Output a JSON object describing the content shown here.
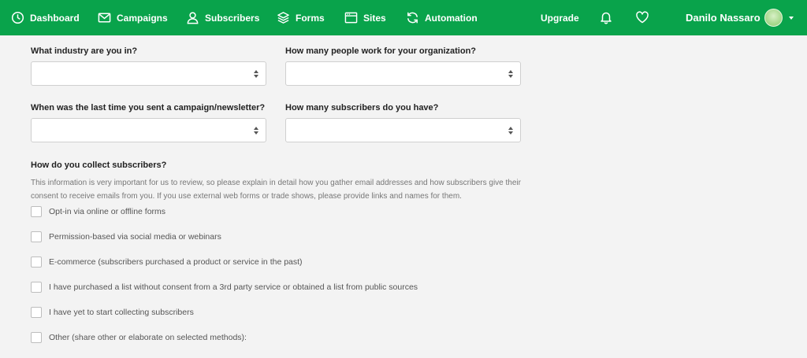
{
  "nav": {
    "dashboard": "Dashboard",
    "campaigns": "Campaigns",
    "subscribers": "Subscribers",
    "forms": "Forms",
    "sites": "Sites",
    "automation": "Automation",
    "upgrade": "Upgrade",
    "bell_icon": "bell-icon",
    "heart_icon": "heart-icon",
    "user_name": "Danilo Nassaro"
  },
  "colors": {
    "brand_green": "#09a34b"
  },
  "form": {
    "industry_label": "What industry are you in?",
    "industry_value": "",
    "people_label": "How many people work for your organization?",
    "people_value": "",
    "last_campaign_label": "When was the last time you sent a campaign/newsletter?",
    "last_campaign_value": "",
    "subscribers_count_label": "How many subscribers do you have?",
    "subscribers_count_value": "",
    "collect_title": "How do you collect subscribers?",
    "collect_description": "This information is very important for us to review, so please explain in detail how you gather email addresses and how subscribers give their consent to receive emails from you. If you use external web forms or trade shows, please provide links and names for them.",
    "options": [
      "Opt-in via online or offline forms",
      "Permission-based via social media or webinars",
      "E-commerce (subscribers purchased a product or service in the past)",
      "I have purchased a list without consent from a 3rd party service or obtained a list from public sources",
      "I have yet to start collecting subscribers",
      "Other (share other or elaborate on selected methods):"
    ]
  }
}
